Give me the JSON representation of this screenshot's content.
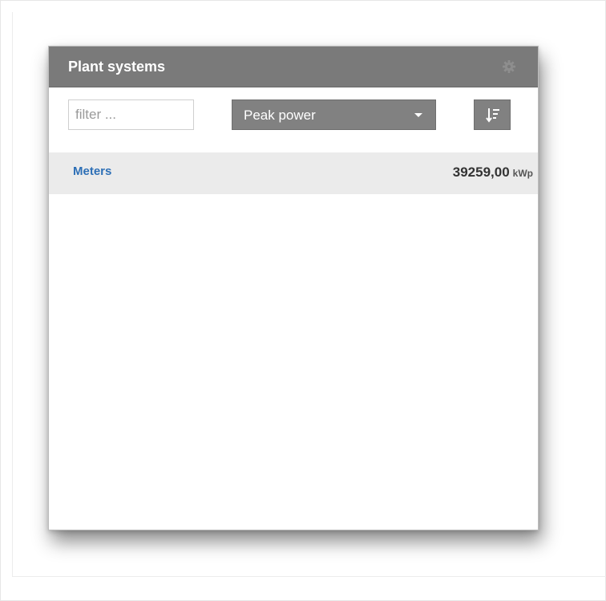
{
  "widget": {
    "title": "Plant systems",
    "settings_icon": "gear-icon"
  },
  "toolbar": {
    "filter": {
      "placeholder": "filter ...",
      "value": ""
    },
    "sort_field": {
      "selected": "Peak power",
      "icon": "chevron-down-icon"
    },
    "sort_button": {
      "icon": "sort-descending-icon"
    }
  },
  "list": {
    "items": [
      {
        "name": "Meters",
        "value": "39259,00",
        "unit": "kWp"
      }
    ]
  },
  "colors": {
    "header_bg": "#7a7a7a",
    "control_bg": "#818181",
    "row_bg": "#ebebeb",
    "link": "#2d6fb6"
  }
}
